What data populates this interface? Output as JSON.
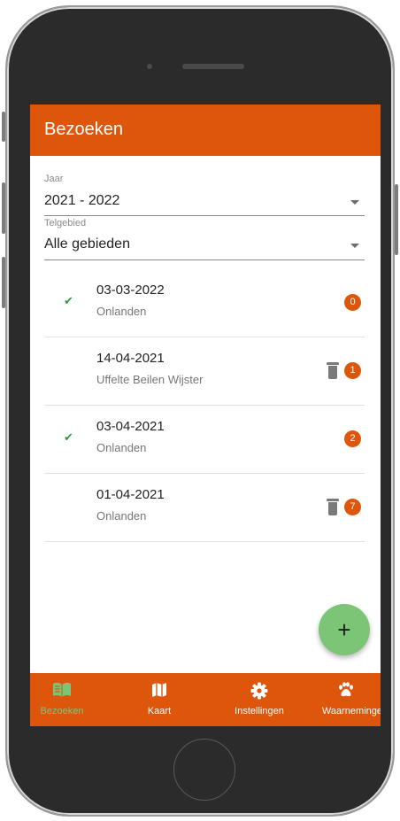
{
  "appbar": {
    "title": "Bezoeken"
  },
  "filters": {
    "year": {
      "label": "Jaar",
      "value": "2021 - 2022"
    },
    "area": {
      "label": "Telgebied",
      "value": "Alle gebieden"
    }
  },
  "visits": [
    {
      "date": "03-03-2022",
      "area": "Onlanden",
      "count": "0",
      "checked": true,
      "deletable": false
    },
    {
      "date": "14-04-2021",
      "area": "Uffelte Beilen Wijster",
      "count": "1",
      "checked": false,
      "deletable": true
    },
    {
      "date": "03-04-2021",
      "area": "Onlanden",
      "count": "2",
      "checked": true,
      "deletable": false
    },
    {
      "date": "01-04-2021",
      "area": "Onlanden",
      "count": "7",
      "checked": false,
      "deletable": true
    }
  ],
  "fab": {
    "label": "+"
  },
  "bottom_nav": [
    {
      "label": "Bezoeken",
      "icon": "book-open-icon",
      "active": true
    },
    {
      "label": "Kaart",
      "icon": "map-icon",
      "active": false
    },
    {
      "label": "Instellingen",
      "icon": "gear-icon",
      "active": false
    },
    {
      "label": "Waarneminge",
      "icon": "paw-icon",
      "active": false
    }
  ],
  "colors": {
    "primary": "#dd560b",
    "accent": "#7dc576",
    "active_tab": "#7dc576",
    "check": "#2e9b3a"
  }
}
